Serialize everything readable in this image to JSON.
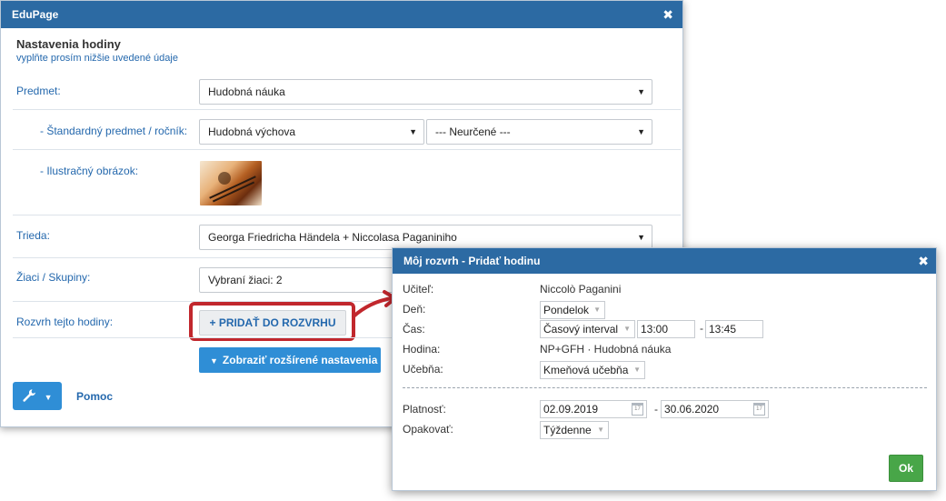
{
  "main": {
    "title": "EduPage",
    "close_glyph": "✖",
    "heading": "Nastavenia hodiny",
    "subheading": "vyplňte prosím nižšie uvedené údaje",
    "fields": {
      "subject_label": "Predmet:",
      "subject_value": "Hudobná náuka",
      "standard_label": "- Štandardný predmet / ročník:",
      "standard_value": "Hudobná výchova",
      "grade_value": "--- Neurčené ---",
      "image_label": "- Ilustračný obrázok:",
      "class_label": "Trieda:",
      "class_value": "Georga Friedricha Händela + Niccolasa Paganiniho",
      "students_label": "Žiaci / Skupiny:",
      "students_value": "Vybraní žiaci: 2",
      "schedule_label": "Rozvrh tejto hodiny:"
    },
    "add_button": "+ PRIDAŤ DO ROZVRHU",
    "advanced_button": "Zobraziť rozšírené nastavenia",
    "help_link": "Pomoc"
  },
  "popup": {
    "title": "Môj rozvrh - Pridať hodinu",
    "teacher_label": "Učiteľ:",
    "teacher_value": "Niccolò Paganini",
    "day_label": "Deň:",
    "day_value": "Pondelok",
    "time_label": "Čas:",
    "time_mode": "Časový interval",
    "time_from": "13:00",
    "time_to": "13:45",
    "time_dash": "-",
    "lesson_label": "Hodina:",
    "lesson_value": "NP+GFH · Hudobná náuka",
    "room_label": "Učebňa:",
    "room_value": "Kmeňová učebňa",
    "validity_label": "Platnosť:",
    "valid_from": "02.09.2019",
    "valid_to": "30.06.2020",
    "valid_dash": "-",
    "repeat_label": "Opakovať:",
    "repeat_value": "Týždenne",
    "ok_button": "Ok",
    "calendar_day": "17"
  },
  "icons": {
    "caret": "▼",
    "wrench": "🔧",
    "chevron": "▾"
  },
  "colors": {
    "titlebar": "#2c6aa3",
    "primary_button": "#2f8ed6",
    "ok_button": "#48a648",
    "highlight": "#c1272d"
  }
}
